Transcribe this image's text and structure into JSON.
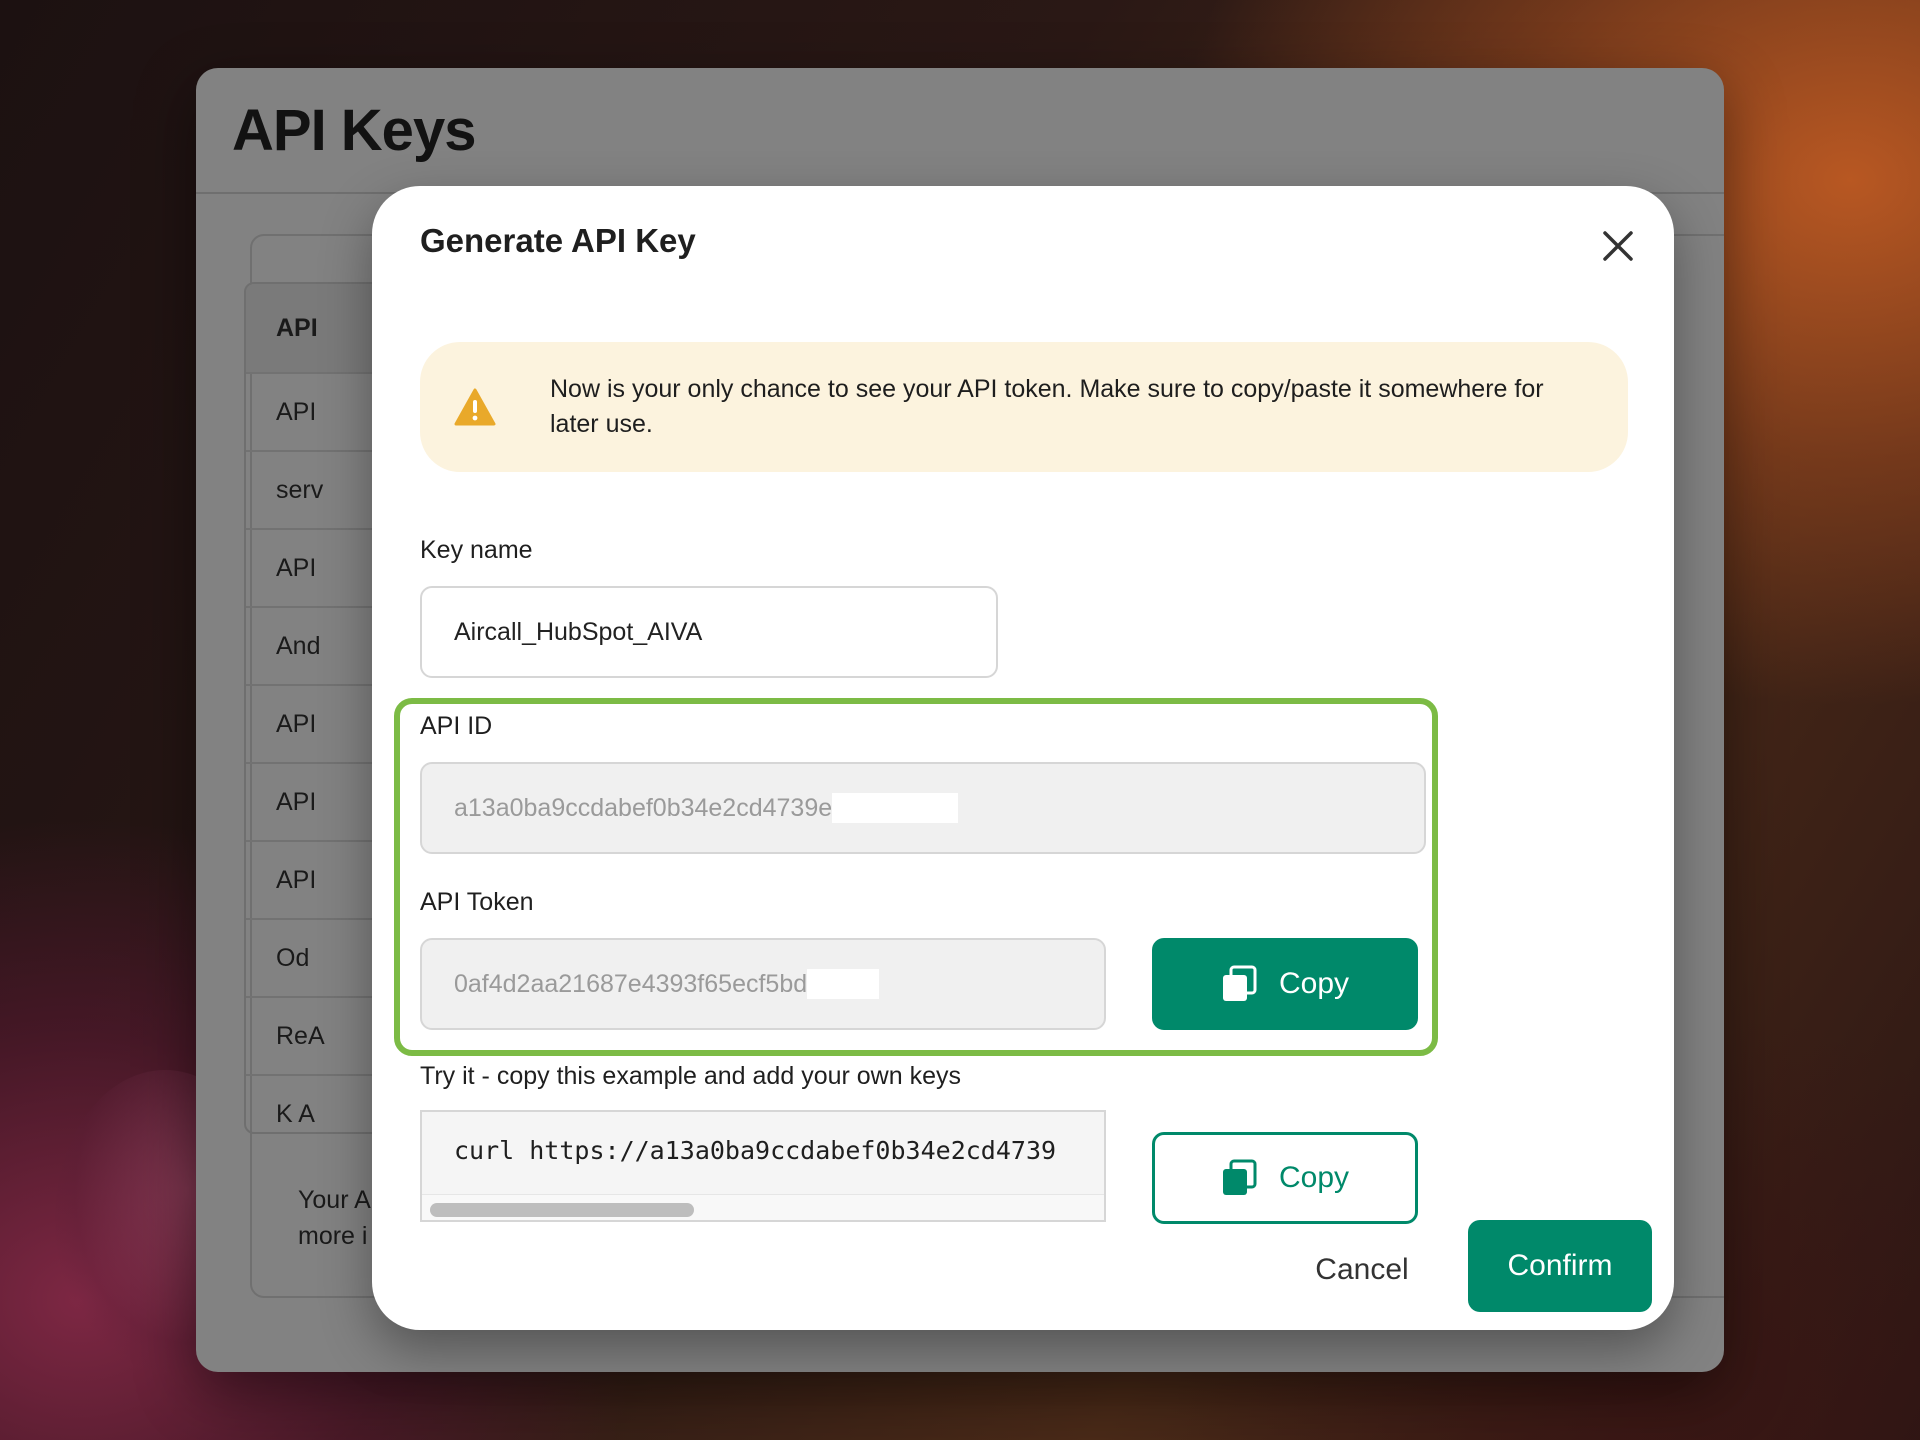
{
  "background_page": {
    "title": "API Keys",
    "table_rows": [
      "API",
      "API",
      "serv",
      "API",
      "And",
      "API",
      "API",
      "API",
      "Od",
      "ReA",
      "K A"
    ],
    "footer_lines": [
      "Your A",
      "more i"
    ]
  },
  "modal": {
    "title": "Generate API Key",
    "close_icon": "close-icon",
    "warning": {
      "icon": "warning-triangle-icon",
      "text": "Now is your only chance to see your API token. Make sure to copy/paste it somewhere for later use."
    },
    "key_name": {
      "label": "Key name",
      "value": "Aircall_HubSpot_AIVA"
    },
    "api_id": {
      "label": "API ID",
      "value": "a13a0ba9ccdabef0b34e2cd4739e"
    },
    "api_token": {
      "label": "API Token",
      "value": "0af4d2aa21687e4393f65ecf5bd"
    },
    "copy_token_button": "Copy",
    "example": {
      "label": "Try it - copy this example and add your own keys",
      "code": "curl https://a13a0ba9ccdabef0b34e2cd4739"
    },
    "copy_example_button": "Copy",
    "cancel_button": "Cancel",
    "confirm_button": "Confirm"
  },
  "colors": {
    "accent": "#00896a",
    "highlight_border": "#7cbb45",
    "warning_bg": "#fcf3de",
    "warning_icon": "#e9a92a"
  }
}
